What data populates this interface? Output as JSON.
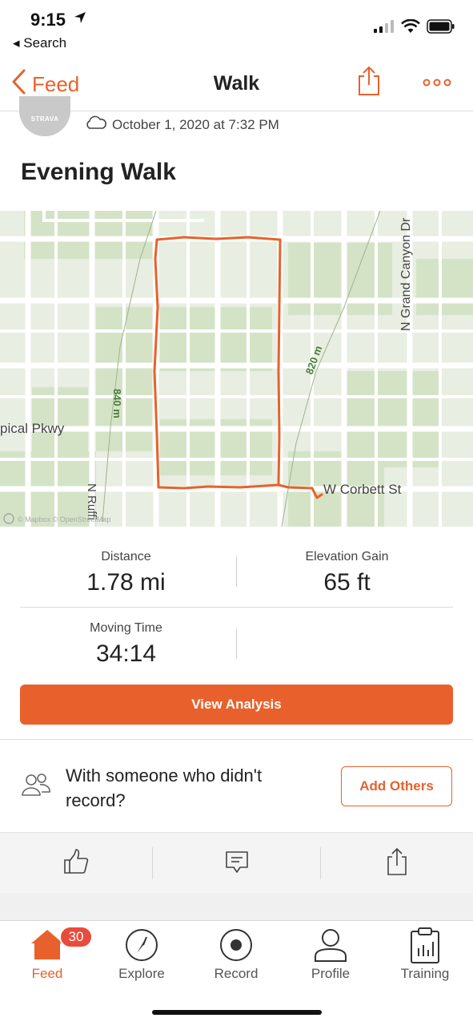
{
  "status_bar": {
    "time": "9:15",
    "back_label": "◂ Search"
  },
  "nav": {
    "back_label": "Feed",
    "title": "Walk"
  },
  "activity": {
    "avatar_text": "STRAVA",
    "date": "October 1, 2020 at 7:32 PM",
    "title": "Evening Walk"
  },
  "map": {
    "labels": {
      "grand_canyon": "N Grand Canyon Dr",
      "tropical": "pical Pkwy",
      "corbett": "W Corbett St",
      "ruffin": "N Ruffi",
      "contour_820": "820 m",
      "contour_840": "840 m",
      "attribution": "© Mapbox © OpenStreetMap"
    },
    "route_color": "#e8612c"
  },
  "stats": {
    "distance": {
      "label": "Distance",
      "value": "1.78 mi"
    },
    "elevation": {
      "label": "Elevation Gain",
      "value": "65 ft"
    },
    "moving_time": {
      "label": "Moving Time",
      "value": "34:14"
    }
  },
  "buttons": {
    "view_analysis": "View Analysis",
    "add_others": "Add Others"
  },
  "others_prompt": "With someone who didn't record?",
  "tabbar": {
    "items": [
      {
        "label": "Feed",
        "icon": "home-icon",
        "active": true
      },
      {
        "label": "Explore",
        "icon": "compass-icon"
      },
      {
        "label": "Record",
        "icon": "record-icon"
      },
      {
        "label": "Profile",
        "icon": "profile-icon"
      },
      {
        "label": "Training",
        "icon": "training-icon"
      }
    ],
    "badge": "30"
  },
  "colors": {
    "accent": "#e8612c",
    "badge": "#e74c3c"
  }
}
